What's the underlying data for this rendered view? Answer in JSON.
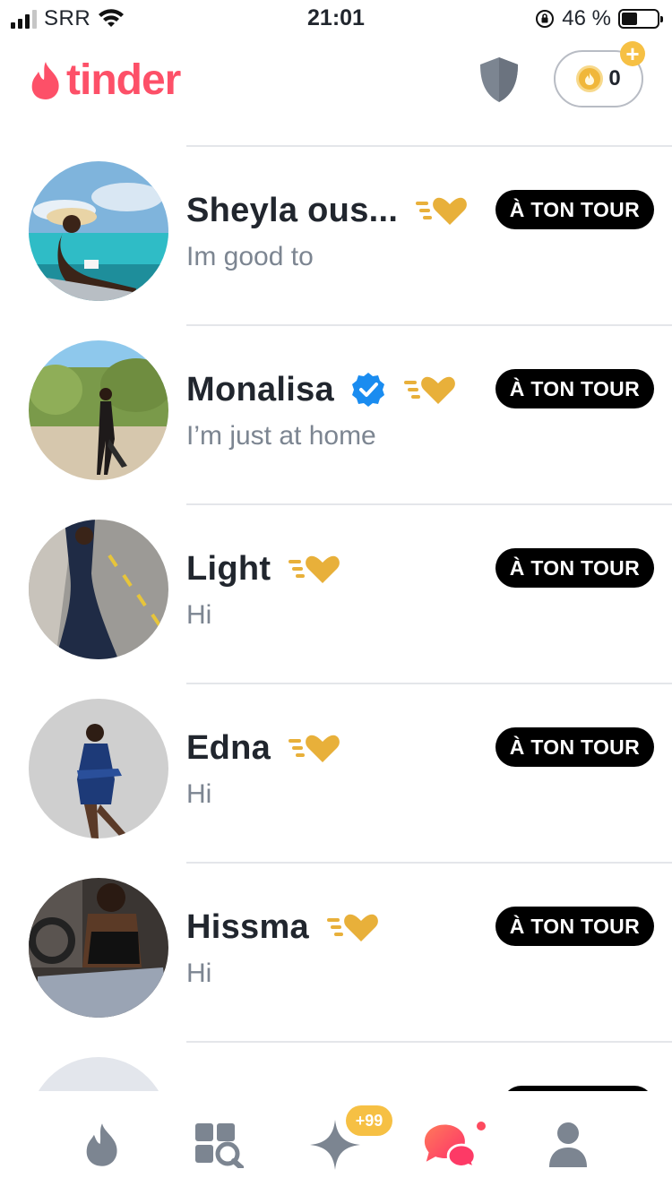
{
  "status_bar": {
    "carrier": "SRR",
    "time": "21:01",
    "battery_percent": "46 %",
    "battery_level": 0.46
  },
  "header": {
    "logo_text": "tinder",
    "coin_count": "0"
  },
  "conversations": [
    {
      "name": "Sheyla ous...",
      "message": "Im good to",
      "badge": "À TON TOUR",
      "verified": false
    },
    {
      "name": "Monalisa",
      "message": "I’m just at home",
      "badge": "À TON TOUR",
      "verified": true
    },
    {
      "name": "Light",
      "message": "Hi",
      "badge": "À TON TOUR",
      "verified": false
    },
    {
      "name": "Edna",
      "message": "Hi",
      "badge": "À TON TOUR",
      "verified": false
    },
    {
      "name": "Hissma",
      "message": "Hi",
      "badge": "À TON TOUR",
      "verified": false
    },
    {
      "name": "",
      "message": "",
      "badge": "",
      "verified": false
    }
  ],
  "bottom_nav": {
    "items": [
      "flame-icon",
      "explore-icon",
      "sparkle-icon",
      "messages-icon",
      "profile-icon"
    ],
    "sparkle_badge": "+99"
  },
  "colors": {
    "brand": "#fd5068",
    "gold": "#f0b73a",
    "badge_bg": "#000000",
    "icon_gray": "#7c8591"
  }
}
